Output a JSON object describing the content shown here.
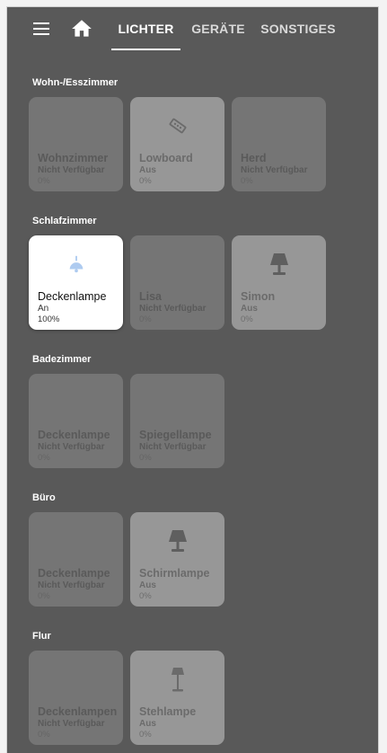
{
  "nav": {
    "tabs": [
      {
        "label": "LICHTER",
        "active": true
      },
      {
        "label": "GERÄTE",
        "active": false
      },
      {
        "label": "SONSTIGES",
        "active": false
      }
    ]
  },
  "colors": {
    "background": "#595959",
    "tile_unavailable": "#757575",
    "tile_off": "#979797",
    "tile_on": "#ffffff",
    "lamp_on_icon": "#aecbf0"
  },
  "sections": [
    {
      "title": "Wohn-/Esszimmer",
      "tiles": [
        {
          "name": "Wohnzimmer",
          "status": "Nicht Verfügbar",
          "percent": "0%",
          "state": "unavailable",
          "icon": ""
        },
        {
          "name": "Lowboard",
          "status": "Aus",
          "percent": "0%",
          "state": "off",
          "icon": "led-strip-icon"
        },
        {
          "name": "Herd",
          "status": "Nicht Verfügbar",
          "percent": "0%",
          "state": "unavailable",
          "icon": ""
        }
      ]
    },
    {
      "title": "Schlafzimmer",
      "tiles": [
        {
          "name": "Deckenlampe",
          "status": "An",
          "percent": "100%",
          "state": "on",
          "icon": "ceiling-light-icon"
        },
        {
          "name": "Lisa",
          "status": "Nicht Verfügbar",
          "percent": "0%",
          "state": "unavailable",
          "icon": ""
        },
        {
          "name": "Simon",
          "status": "Aus",
          "percent": "0%",
          "state": "off",
          "icon": "table-lamp-icon"
        }
      ]
    },
    {
      "title": "Badezimmer",
      "tiles": [
        {
          "name": "Deckenlampe",
          "status": "Nicht Verfügbar",
          "percent": "0%",
          "state": "unavailable",
          "icon": ""
        },
        {
          "name": "Spiegellampe",
          "status": "Nicht Verfügbar",
          "percent": "0%",
          "state": "unavailable",
          "icon": ""
        }
      ]
    },
    {
      "title": "Büro",
      "tiles": [
        {
          "name": "Deckenlampe",
          "status": "Nicht Verfügbar",
          "percent": "0%",
          "state": "unavailable",
          "icon": ""
        },
        {
          "name": "Schirmlampe",
          "status": "Aus",
          "percent": "0%",
          "state": "off",
          "icon": "table-lamp-icon"
        }
      ]
    },
    {
      "title": "Flur",
      "tiles": [
        {
          "name": "Deckenlampen",
          "status": "Nicht Verfügbar",
          "percent": "0%",
          "state": "unavailable",
          "icon": ""
        },
        {
          "name": "Stehlampe",
          "status": "Aus",
          "percent": "0%",
          "state": "off",
          "icon": "floor-lamp-icon"
        }
      ]
    }
  ]
}
